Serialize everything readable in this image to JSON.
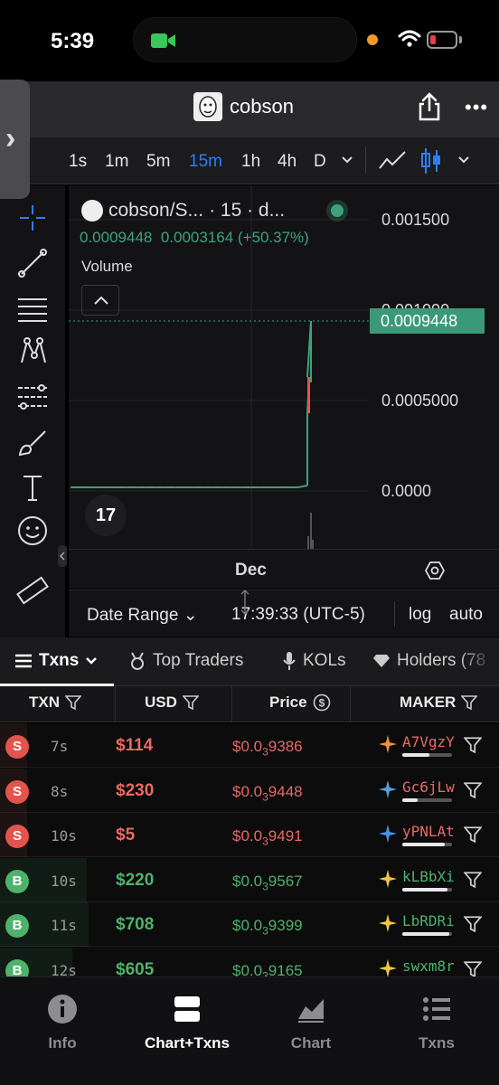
{
  "status_bar": {
    "time": "5:39"
  },
  "header": {
    "title": "cobson"
  },
  "toolbar": {
    "timeframes": [
      "1s",
      "1m",
      "5m",
      "15m",
      "1h",
      "4h",
      "D"
    ],
    "active_timeframe": "15m"
  },
  "chart": {
    "symbol": "cobson/S...",
    "interval": "· 15 · d...",
    "ohlc_open": "0.0009448",
    "ohlc_change": "0.0003164 (+50.37%)",
    "volume_label": "Volume",
    "y_ticks": [
      "0.001500",
      "0.001000",
      "0.0005000",
      "0.0000"
    ],
    "current_price": "0.0009448",
    "x_label": "Dec",
    "tv_logo": "17",
    "date_range_label": "Date Range",
    "clock": "17:39:33 (UTC-5)",
    "log_label": "log",
    "auto_label": "auto",
    "colors": {
      "up": "#3ea27a",
      "down": "#e8554b"
    }
  },
  "chart_data": {
    "type": "line",
    "title": "",
    "ylabel": "",
    "ylim": [
      0,
      0.0016
    ],
    "series": [
      {
        "values": [
          2e-05,
          2e-05,
          2e-05,
          2e-05,
          2e-05,
          2e-05,
          2e-05,
          2e-05,
          2e-05,
          2e-05,
          2e-05,
          2e-05,
          2e-05,
          2e-05,
          2e-05,
          2e-05,
          2e-05,
          2e-05,
          2e-05,
          2e-05,
          2e-05,
          2e-05,
          2e-05,
          2e-05,
          2e-05,
          3e-05,
          0.00043,
          0.00063,
          0.00094
        ]
      }
    ]
  },
  "tabs": [
    {
      "label": "Txns",
      "icon": "list-icon"
    },
    {
      "label": "Top Traders",
      "icon": "medal-icon"
    },
    {
      "label": "KOLs",
      "icon": "mic-icon"
    },
    {
      "label": "Holders (78",
      "icon": "diamond-icon"
    }
  ],
  "table": {
    "headers": {
      "txn": "TXN",
      "usd": "USD",
      "price": "Price",
      "maker": "MAKER"
    },
    "rows": [
      {
        "type": "S",
        "age": "7s",
        "usd": "$114",
        "price_prefix": "$0.0",
        "price_sub": "3",
        "price_digits": "9386",
        "maker": "A7VgzY",
        "maker_share": 0.55,
        "icon": "bird-icon"
      },
      {
        "type": "S",
        "age": "8s",
        "usd": "$230",
        "price_prefix": "$0.0",
        "price_sub": "3",
        "price_digits": "9448",
        "maker": "Gc6jLw",
        "maker_share": 0.3,
        "icon": "dolphin-icon"
      },
      {
        "type": "S",
        "age": "10s",
        "usd": "$5",
        "price_prefix": "$0.0",
        "price_sub": "3",
        "price_digits": "9491",
        "maker": "yPNLAt",
        "maker_share": 0.85,
        "icon": "sail-icon"
      },
      {
        "type": "B",
        "age": "10s",
        "usd": "$220",
        "price_prefix": "$0.0",
        "price_sub": "3",
        "price_digits": "9567",
        "maker": "kLBbXi",
        "maker_share": 0.9,
        "icon": "sparkle-icon"
      },
      {
        "type": "B",
        "age": "11s",
        "usd": "$708",
        "price_prefix": "$0.0",
        "price_sub": "3",
        "price_digits": "9399",
        "maker": "LbRDRi",
        "maker_share": 0.95,
        "icon": "sparkle-icon"
      },
      {
        "type": "B",
        "age": "12s",
        "usd": "$605",
        "price_prefix": "$0.0",
        "price_sub": "3",
        "price_digits": "9165",
        "maker": "swxm8r",
        "maker_share": 0.5,
        "icon": "sparkle-icon"
      }
    ]
  },
  "bottom_nav": [
    {
      "label": "Info",
      "icon": "info-icon"
    },
    {
      "label": "Chart+Txns",
      "icon": "split-view-icon"
    },
    {
      "label": "Chart",
      "icon": "area-chart-icon"
    },
    {
      "label": "Txns",
      "icon": "list-icon"
    }
  ],
  "active_nav": "Chart+Txns"
}
